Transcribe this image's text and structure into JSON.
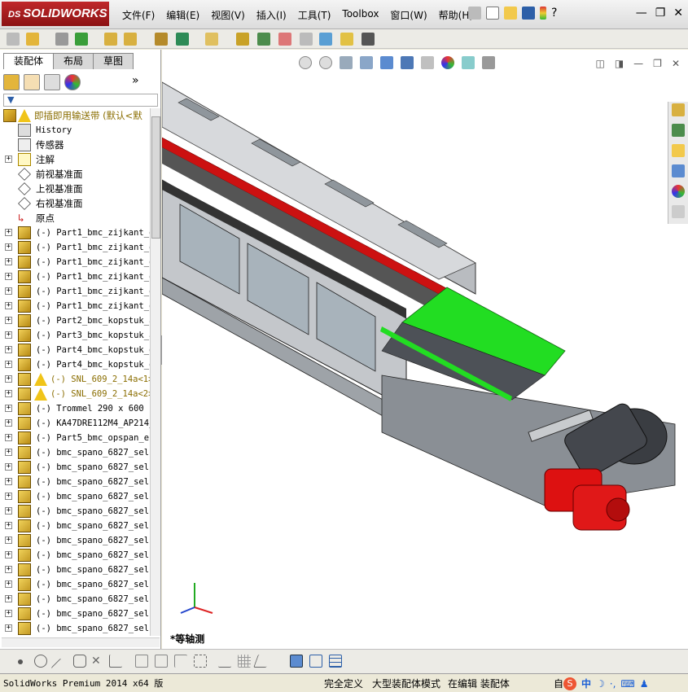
{
  "app": {
    "brand": "SOLIDWORKS",
    "brand_prefix": "DS"
  },
  "menu": [
    "文件(F)",
    "编辑(E)",
    "视图(V)",
    "插入(I)",
    "工具(T)",
    "Toolbox",
    "窗口(W)",
    "帮助(H)"
  ],
  "tabs": [
    {
      "label": "装配体",
      "active": true
    },
    {
      "label": "布局",
      "active": false
    },
    {
      "label": "草图",
      "active": false
    }
  ],
  "tree": {
    "root_label": "即插即用输送带  (默认<默",
    "items": [
      {
        "label": "History",
        "icon": "history-icon",
        "expand": false
      },
      {
        "label": "传感器",
        "icon": "sensor-icon",
        "expand": false
      },
      {
        "label": "注解",
        "icon": "annotation-icon",
        "expand": true
      },
      {
        "label": "前视基准面",
        "icon": "plane-icon",
        "expand": false
      },
      {
        "label": "上视基准面",
        "icon": "plane-icon",
        "expand": false
      },
      {
        "label": "右视基准面",
        "icon": "plane-icon",
        "expand": false
      },
      {
        "label": "原点",
        "icon": "origin-icon",
        "expand": false
      },
      {
        "label": "(-) Part1_bmc_zijkant_d",
        "icon": "part-icon",
        "expand": true
      },
      {
        "label": "(-) Part1_bmc_zijkant_d",
        "icon": "part-icon",
        "expand": true
      },
      {
        "label": "(-) Part1_bmc_zijkant_d",
        "icon": "part-icon",
        "expand": true
      },
      {
        "label": "(-) Part1_bmc_zijkant_d",
        "icon": "part-icon",
        "expand": true
      },
      {
        "label": "(-) Part1_bmc_zijkant_d",
        "icon": "part-icon",
        "expand": true
      },
      {
        "label": "(-) Part1_bmc_zijkant_d",
        "icon": "part-icon",
        "expand": true
      },
      {
        "label": "(-) Part2_bmc_kopstuk_a",
        "icon": "part-icon",
        "expand": true
      },
      {
        "label": "(-) Part3_bmc_kopstuk_a",
        "icon": "part-icon",
        "expand": true
      },
      {
        "label": "(-) Part4_bmc_kopstuk_d",
        "icon": "part-icon",
        "expand": true
      },
      {
        "label": "(-) Part4_bmc_kopstuk_d",
        "icon": "part-icon",
        "expand": true
      },
      {
        "label": "(-) SNL_609_2_14a<1>",
        "icon": "warning-icon",
        "expand": true,
        "warn": true
      },
      {
        "label": "(-) SNL_609_2_14a<2>",
        "icon": "warning-icon",
        "expand": true,
        "warn": true
      },
      {
        "label": "(-) Trommel 290 x 600 -",
        "icon": "subassembly-icon",
        "expand": true
      },
      {
        "label": "(-) KA47DRE112M4_AP214_",
        "icon": "subassembly-icon",
        "expand": true
      },
      {
        "label": "(-) Part5_bmc_opspan_ei",
        "icon": "part-icon",
        "expand": true
      },
      {
        "label": "(-) bmc_spano_6827_self",
        "icon": "subassembly-icon",
        "expand": true
      },
      {
        "label": "(-) bmc_spano_6827_self",
        "icon": "subassembly-icon",
        "expand": true
      },
      {
        "label": "(-) bmc_spano_6827_self",
        "icon": "subassembly-icon",
        "expand": true
      },
      {
        "label": "(-) bmc_spano_6827_self",
        "icon": "subassembly-icon",
        "expand": true
      },
      {
        "label": "(-) bmc_spano_6827_self",
        "icon": "subassembly-icon",
        "expand": true
      },
      {
        "label": "(-) bmc_spano_6827_self",
        "icon": "subassembly-icon",
        "expand": true
      },
      {
        "label": "(-) bmc_spano_6827_self",
        "icon": "subassembly-icon",
        "expand": true
      },
      {
        "label": "(-) bmc_spano_6827_self",
        "icon": "subassembly-icon",
        "expand": true
      },
      {
        "label": "(-) bmc_spano_6827_self",
        "icon": "subassembly-icon",
        "expand": true
      },
      {
        "label": "(-) bmc_spano_6827_self",
        "icon": "subassembly-icon",
        "expand": true
      },
      {
        "label": "(-) bmc_spano_6827_self",
        "icon": "subassembly-icon",
        "expand": true
      },
      {
        "label": "(-) bmc_spano_6827_self",
        "icon": "subassembly-icon",
        "expand": true
      },
      {
        "label": "(-) bmc_spano_6827_self",
        "icon": "subassembly-icon",
        "expand": true
      }
    ]
  },
  "viewport": {
    "view_name": "*等轴测"
  },
  "status": {
    "product": "SolidWorks Premium 2014 x64 版",
    "definition": "完全定义",
    "mode": "大型装配体模式",
    "editing": "在编辑 装配体",
    "custom": "自"
  },
  "colors": {
    "accent": "#c0282a",
    "highlight_green": "#22dd22",
    "belt_red": "#cc1111",
    "motor_red": "#dd1111"
  }
}
